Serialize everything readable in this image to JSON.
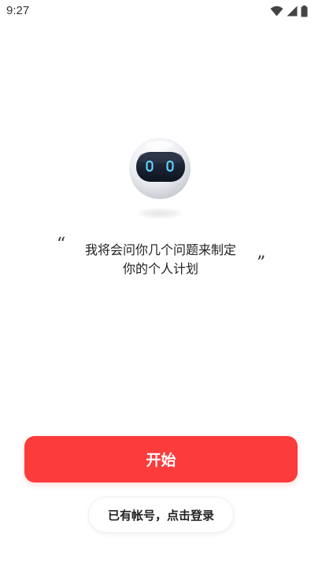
{
  "status_bar": {
    "time": "9:27",
    "icons": [
      "wifi-icon",
      "signal-icon",
      "battery-icon"
    ]
  },
  "intro": {
    "illustration": "robot-icon",
    "quote_open": "“",
    "quote_close": "”",
    "line1": "我将会问你几个问题来制定",
    "line2": "你的个人计划"
  },
  "actions": {
    "start_label": "开始",
    "login_label": "已有帐号，点击登录"
  },
  "colors": {
    "accent": "#fc3b3b",
    "text": "#222222",
    "background": "#ffffff"
  }
}
